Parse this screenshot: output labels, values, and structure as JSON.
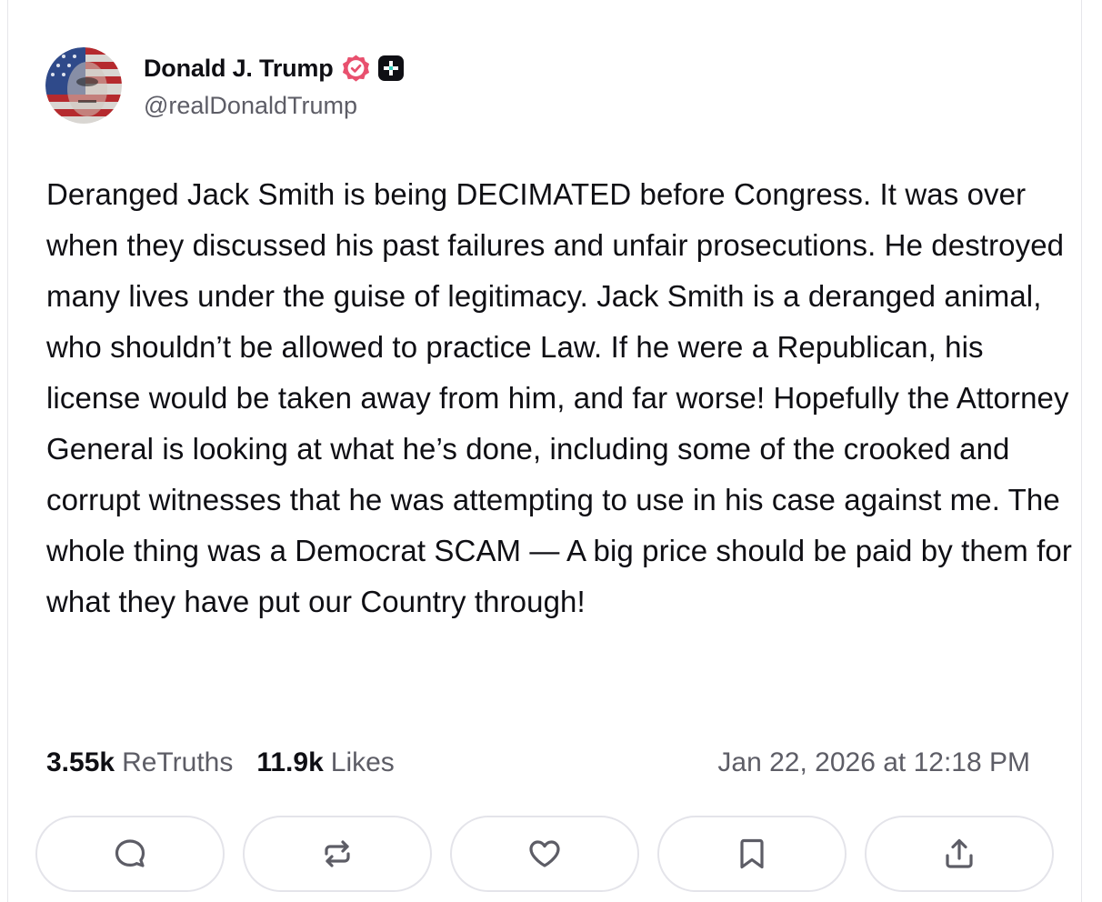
{
  "post": {
    "author_name": "Donald J. Trump",
    "handle": "@realDonaldTrump",
    "text": "Deranged Jack Smith is being DECIMATED before Congress. It was over when they discussed his past failures and unfair prosecutions. He destroyed many lives under the guise of legitimacy. Jack Smith is a deranged animal, who shouldn’t be allowed to practice Law. If he were a Republican, his license would be taken away from him, and far worse! Hopefully the Attorney General is looking at what he’s done, including some of the crooked and corrupt witnesses that he was attempting to use in his case against me. The whole thing was a Democrat SCAM — A big price should be paid by them for what they have put our Country through!",
    "retruths_count": "3.55k",
    "retruths_label": "ReTruths",
    "likes_count": "11.9k",
    "likes_label": "Likes",
    "timestamp": "Jan 22, 2026 at 12:18 PM"
  },
  "icons": {
    "verified": "verified-badge-icon",
    "plus": "plus-badge-icon",
    "actions": [
      "reply-icon",
      "retruth-icon",
      "like-icon",
      "bookmark-icon",
      "share-icon"
    ]
  },
  "colors": {
    "verified_badge": "#e8506e",
    "text_primary": "#0f0f14",
    "text_secondary": "#5d5d66",
    "border": "#e4e4ea"
  }
}
